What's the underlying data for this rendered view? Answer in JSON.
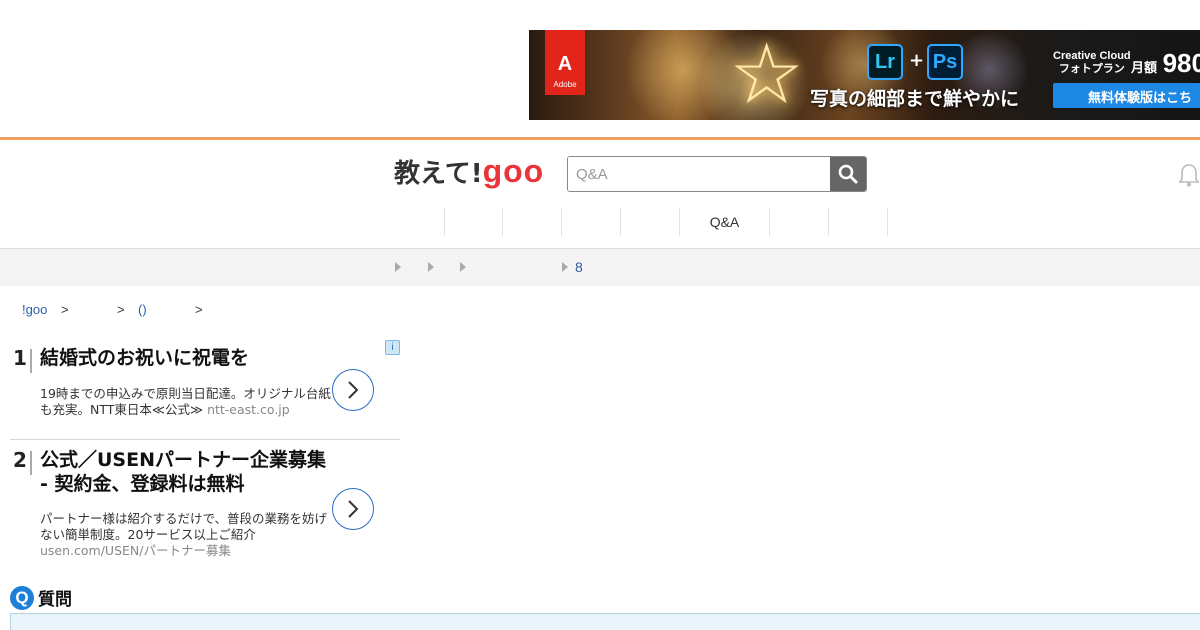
{
  "banner": {
    "brand": "Adobe",
    "brand_mark": "A",
    "app1": "Lr",
    "app2": "Ps",
    "plus": "+",
    "tagline": "写真の細部まで鮮やかに",
    "cc_title_line1": "Creative Cloud",
    "cc_title_line2": "フォトプラン",
    "price_prefix": "月額",
    "price": "980",
    "cta": "無料体験版はこち"
  },
  "header": {
    "logo_jp": "教えて!",
    "logo_goo": "goo",
    "search_placeholder": "Q&A"
  },
  "nav": {
    "tabs": [
      "",
      "",
      "",
      "",
      "Q&A",
      "",
      ""
    ]
  },
  "subnav": {
    "count": "8"
  },
  "breadcrumb": {
    "home": "!goo",
    "sep1": ">",
    "sep2": ">",
    "item": "()",
    "sep3": ">"
  },
  "ads": [
    {
      "rank": "1",
      "title": "結婚式のお祝いに祝電を",
      "desc": "19時までの申込みで原則当日配達。オリジナル台紙も充実。NTT東日本≪公式≫",
      "url": "ntt-east.co.jp"
    },
    {
      "rank": "2",
      "title": "公式／USENパートナー企業募集 - 契約金、登録料は無料",
      "desc": "パートナー様は紹介するだけで、普段の業務を妨げない簡単制度。20サービス以上ご紹介",
      "url": "usen.com/USEN/パートナー募集"
    }
  ],
  "ad_info_icon": "i",
  "question": {
    "icon": "Q",
    "label": "質問"
  }
}
